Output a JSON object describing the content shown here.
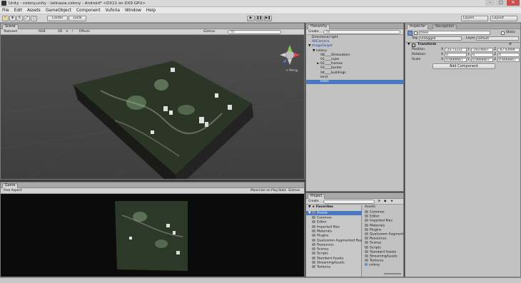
{
  "window": {
    "title": "Unity - colony.unity - latinasia.colony - Android* <DX11 on DX9 GPU>",
    "buttons": [
      "–",
      "□",
      "✕"
    ]
  },
  "menu": [
    "File",
    "Edit",
    "Assets",
    "GameObject",
    "Component",
    "Vuforia",
    "Window",
    "Help"
  ],
  "toolbar": {
    "pivot": "Center",
    "space": "Local",
    "layers": "Layers",
    "layout": "Layout"
  },
  "scene": {
    "tab": "Scene",
    "shading": "Textured",
    "render": "RGB",
    "mode2d": "2D",
    "effects": "Effects",
    "gizmos": "Gizmos",
    "search_placeholder": "All",
    "persp_label": "< Persp"
  },
  "game": {
    "tab": "Game",
    "aspect": "Free Aspect",
    "maximize": "Maximize on Play",
    "stats": "Stats",
    "gizmos": "Gizmos"
  },
  "hierarchy": {
    "tab": "Hierarchy",
    "create": "Create",
    "search_placeholder": "All",
    "items": [
      {
        "label": "Directional light",
        "indent": 0,
        "arrow": "",
        "selected": false,
        "blue": false
      },
      {
        "label": "ARCamera",
        "indent": 0,
        "arrow": "",
        "selected": false,
        "blue": true
      },
      {
        "label": "ImageTarget",
        "indent": 0,
        "arrow": "▼",
        "selected": false,
        "blue": true
      },
      {
        "label": "colony",
        "indent": 1,
        "arrow": "▼",
        "selected": false,
        "blue": false
      },
      {
        "label": "08____Stroesators",
        "indent": 2,
        "arrow": "",
        "selected": false,
        "blue": false
      },
      {
        "label": "01____rojas",
        "indent": 2,
        "arrow": "",
        "selected": false,
        "blue": false
      },
      {
        "label": "02____frames",
        "indent": 2,
        "arrow": "►",
        "selected": false,
        "blue": false
      },
      {
        "label": "03____border",
        "indent": 2,
        "arrow": "",
        "selected": false,
        "blue": false
      },
      {
        "label": "04____buildings",
        "indent": 2,
        "arrow": "",
        "selected": false,
        "blue": false
      },
      {
        "label": "land",
        "indent": 2,
        "arrow": "",
        "selected": false,
        "blue": false
      },
      {
        "label": "trees",
        "indent": 2,
        "arrow": "",
        "selected": true,
        "blue": false
      }
    ]
  },
  "inspector": {
    "tabs": [
      "Inspector",
      "Navigation"
    ],
    "object_name": "trees",
    "static_label": "Static",
    "tag_label": "Tag",
    "tag_value": "Untagged",
    "layer_label": "Layer",
    "layer_value": "Default",
    "transform_title": "Transform",
    "rows": [
      {
        "label": "Position",
        "x": "-23.73333",
        "y": "-193.6667",
        "z": "-67.93999"
      },
      {
        "label": "Rotation",
        "x": "0",
        "y": "0",
        "z": "0"
      },
      {
        "label": "Scale",
        "x": "0.6666667",
        "y": "0.6666667",
        "z": "0.6666667"
      }
    ],
    "axis": [
      "X",
      "Y",
      "Z"
    ],
    "add_component": "Add Component"
  },
  "project": {
    "tab": "Project",
    "create": "Create",
    "favorites": "Favorites",
    "assets_root": "Assets",
    "tree": [
      "Common",
      "Editor",
      "Imported files",
      "Materials",
      "Plugins",
      "Qualcomm Augmented Rea",
      "Resources",
      "Scenes",
      "Scripts",
      "Standard Assets",
      "StreamingAssets",
      "Textures"
    ],
    "breadcrumb": "Assets",
    "grid": [
      "Common",
      "Editor",
      "Imported files",
      "Materials",
      "Plugins",
      "Qualcomm Augmented",
      "Resources",
      "Scenes",
      "Scripts",
      "Standard Assets",
      "StreamingAssets",
      "Textures",
      "colony"
    ]
  }
}
